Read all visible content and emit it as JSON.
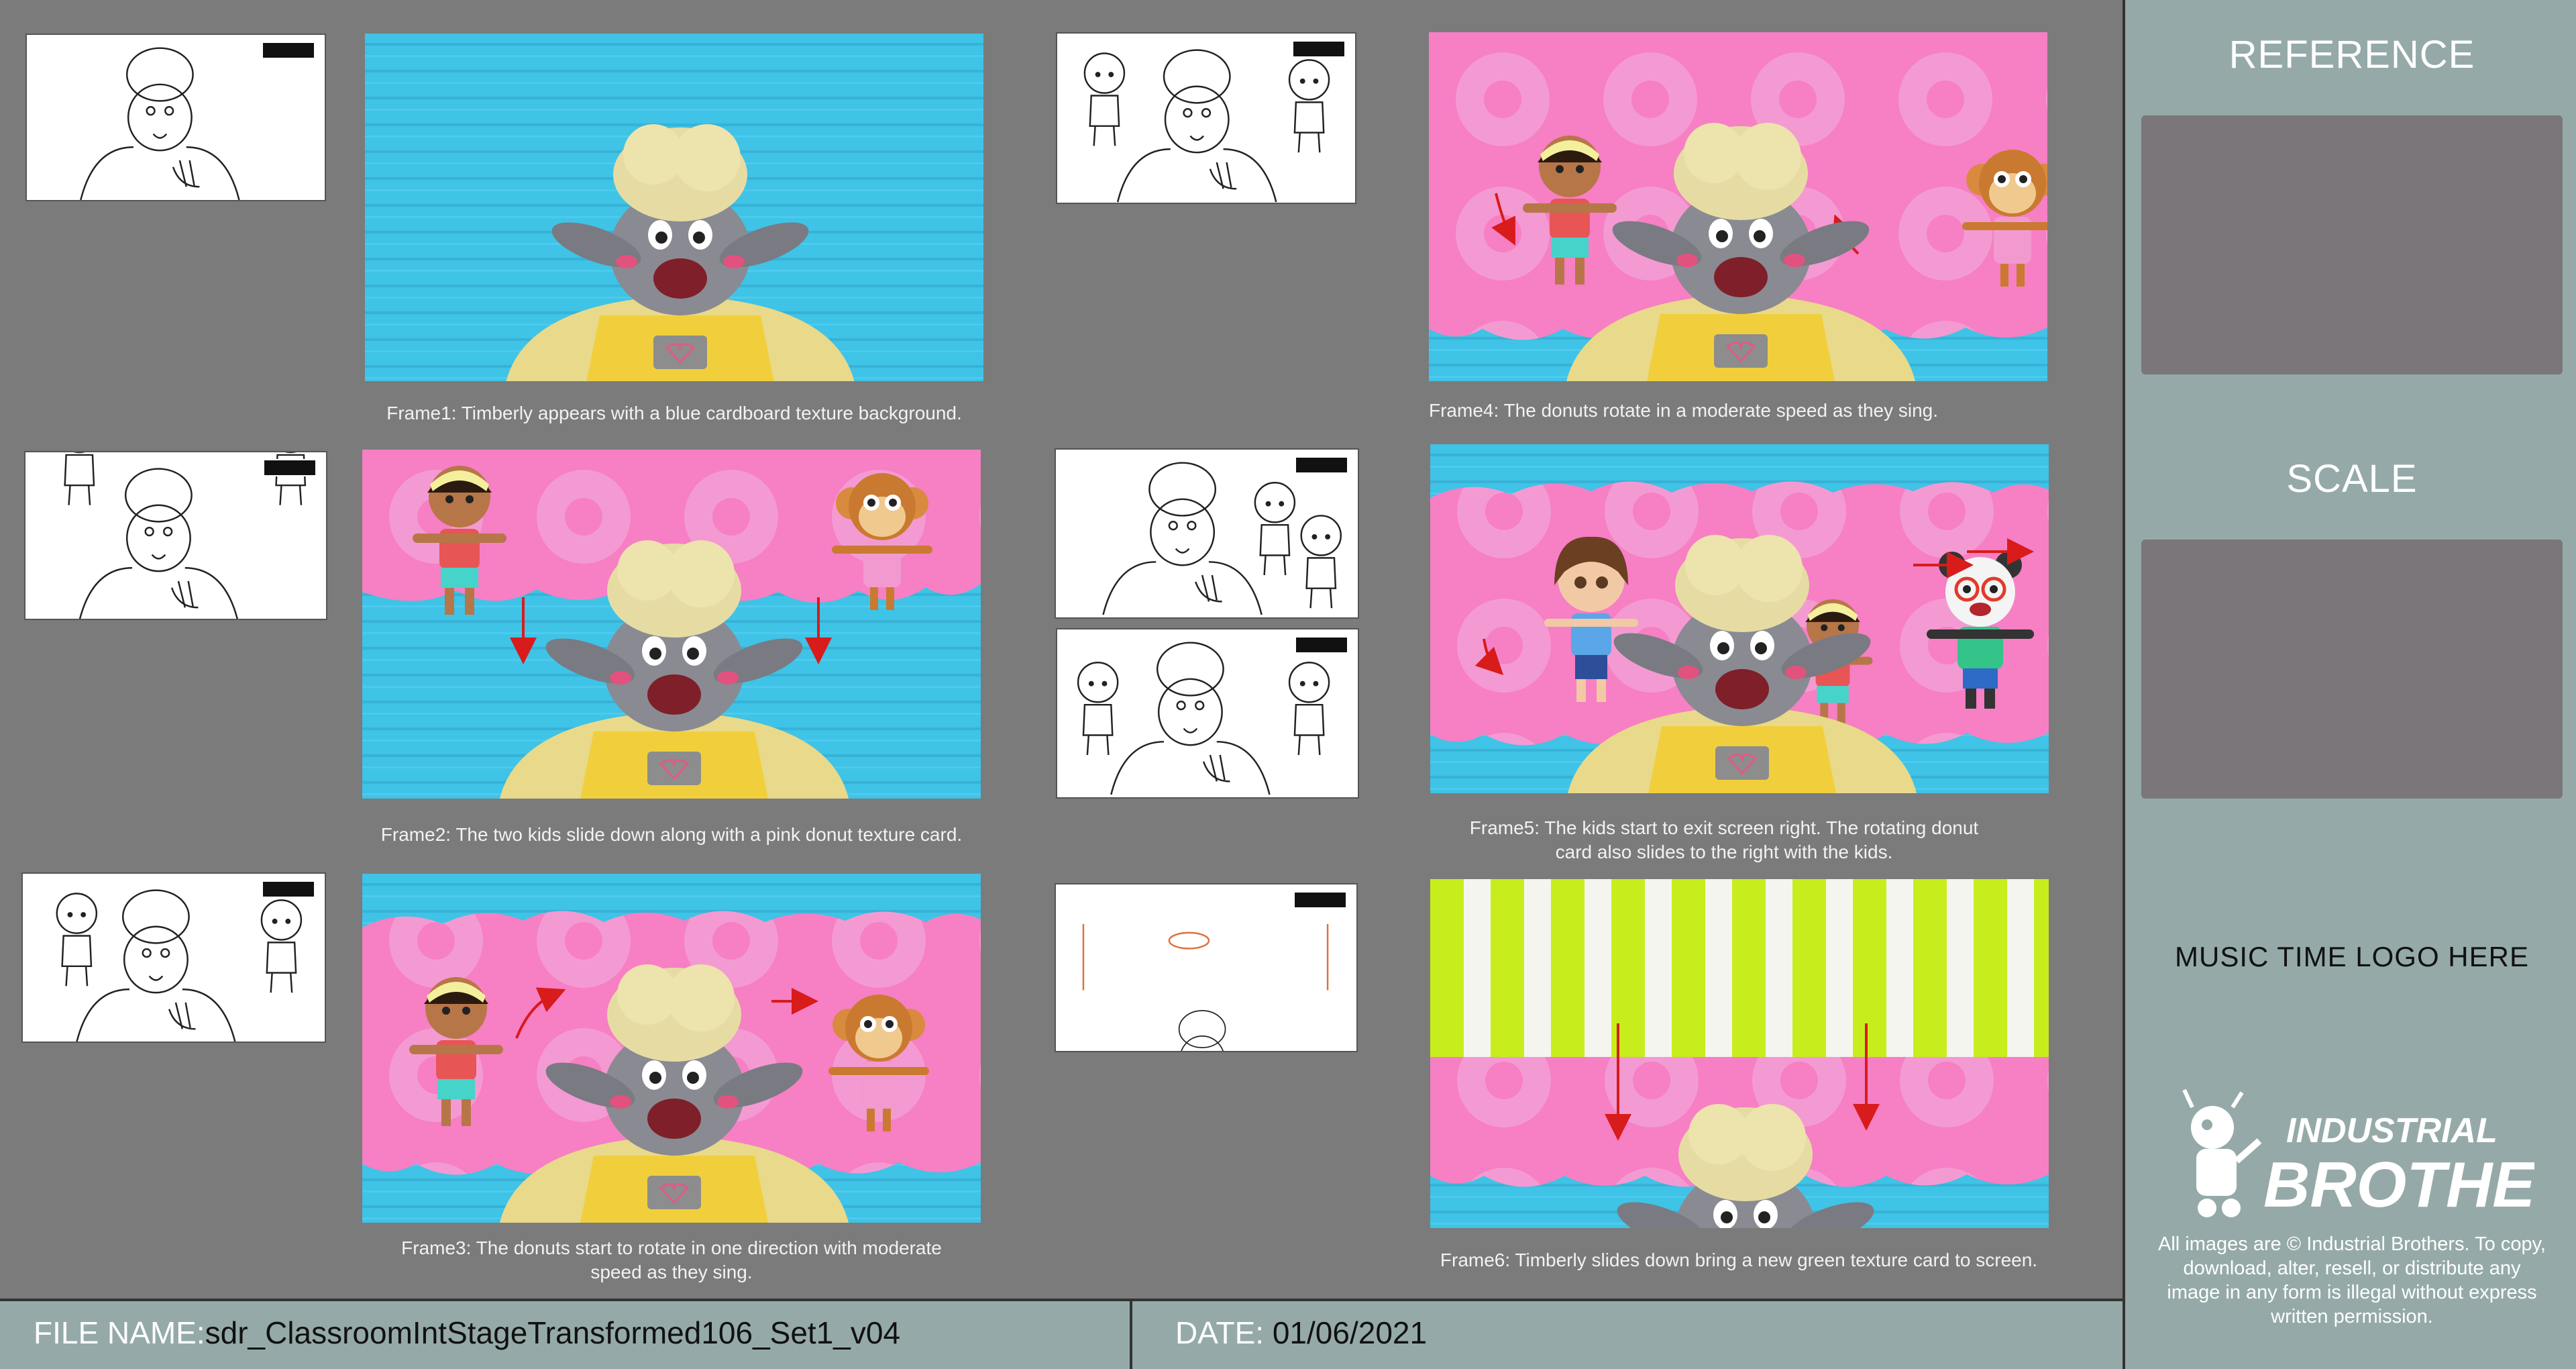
{
  "frames": [
    {
      "caption": "Frame1: Timberly appears with a blue cardboard texture background."
    },
    {
      "caption": "Frame2: The two kids slide down along with a pink donut texture card."
    },
    {
      "caption": "Frame3: The donuts start to rotate in one direction with moderate speed as they sing."
    },
    {
      "caption": "Frame4: The donuts rotate in a moderate speed as they sing."
    },
    {
      "caption": "Frame5: The kids start to exit screen right. The rotating donut card also slides to the right with the kids."
    },
    {
      "caption": "Frame6: Timberly slides down bring a new green texture card to screen."
    }
  ],
  "sidebar": {
    "reference_label": "REFERENCE",
    "scale_label": "SCALE",
    "logo_placeholder": "MUSIC TIME LOGO HERE",
    "brand_line1": "INDUSTRIAL",
    "brand_line2": "BROTHERS",
    "copyright": "All images are © Industrial Brothers. To copy, download, alter, resell, or distribute any image in any form is illegal without express written permission."
  },
  "footer": {
    "file_label": "FILE NAME:",
    "file_value": "sdr_ClassroomIntStageTransformed106_Set1_v04",
    "date_label": "DATE:",
    "date_value": "01/06/2021"
  },
  "colors": {
    "panel_bg": "#7b7b7b",
    "sidebar_bg": "#95aaa8",
    "blue_card": "#3fc3e6",
    "pink_card": "#f77fc4",
    "green_card": "#c7ee1c",
    "arrow_red": "#d81b1b"
  }
}
